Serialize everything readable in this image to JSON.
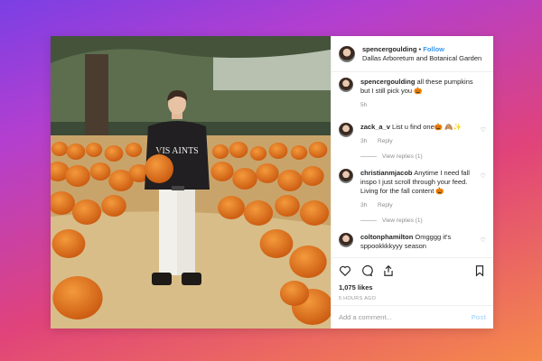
{
  "header": {
    "username": "spencergoulding",
    "separator": "•",
    "follow_label": "Follow",
    "location": "Dallas Arboretum and Botanical Garden"
  },
  "caption": {
    "username": "spencergoulding",
    "text": "all these pumpkins but I still pick you 🎃",
    "time": "5h"
  },
  "comments": [
    {
      "username": "zack_a_v",
      "text": "List u find one🎃 🙈✨",
      "time": "3h",
      "reply": "Reply",
      "view_replies": "View replies (1)"
    },
    {
      "username": "christianmjacob",
      "text": "Anytime I need fall inspo I just scroll through your feed. Living for the fall content 🎃",
      "time": "3h",
      "reply": "Reply",
      "view_replies": "View replies (1)"
    },
    {
      "username": "coltonphamilton",
      "text": "Omgggg it's sppookkkkyyy season"
    }
  ],
  "actions": {
    "likes": "1,075 likes",
    "time_ago": "5 HOURS AGO"
  },
  "add_comment": {
    "placeholder": "Add a comment...",
    "post_label": "Post"
  },
  "photo": {
    "sweater_text": "VIS AINTS"
  },
  "colors": {
    "follow": "#3897f0",
    "post_disabled": "#b3dbff",
    "pumpkin": "#e0701a"
  }
}
